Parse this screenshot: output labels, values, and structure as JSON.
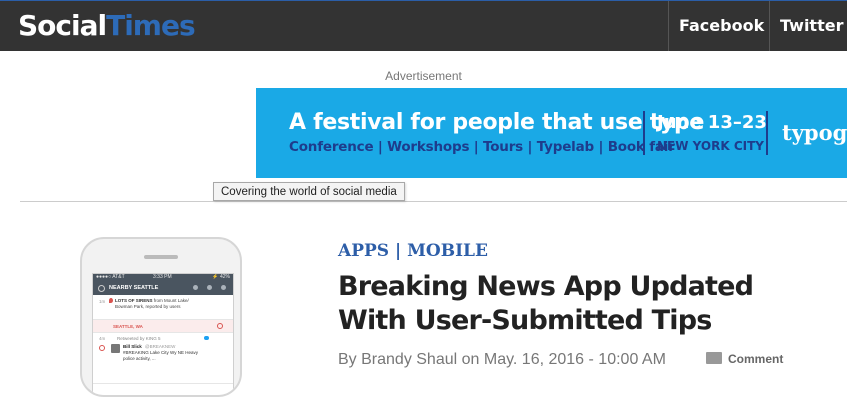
{
  "header": {
    "logo_part1": "Social",
    "logo_part2": "Times",
    "nav": [
      {
        "label": "Facebook"
      },
      {
        "label": "Twitter"
      }
    ],
    "colors": {
      "bar": "#333333",
      "logo_accent": "#2d6bb8"
    }
  },
  "ad": {
    "label": "Advertisement",
    "headline": "A festival for people that use type",
    "subline": "Conference | Workshops | Tours | Typelab | Book fair",
    "dates": "June 13–23",
    "city": "NEW YORK CITY",
    "brand": "typog",
    "colors": {
      "background": "#1aa9e6",
      "accent": "#1e3c8c"
    }
  },
  "tooltip": {
    "text": "Covering the world of social media"
  },
  "article": {
    "categories": [
      "APPS",
      "MOBILE"
    ],
    "category_separator": "|",
    "title": "Breaking News App Updated With User-Submitted Tips",
    "byline": "By Brandy Shaul on May. 16, 2016 - 10:00 AM",
    "comment_label": "Comment",
    "thumbnail": {
      "status_carrier": "●●●●○ AT&T",
      "status_time": "3:33 PM",
      "status_battery": "⚡ 42%",
      "header_title": "NEARBY SEATTLE",
      "item1_time": "1m",
      "item1_text_bold": "LOTS OF SIRENS",
      "item1_text": "from Mount Lake/ Bowman Park, reported by users",
      "item2_label": "SEATTLE, WA",
      "item3_time": "4m",
      "item3_retweet": "Retweeted by KING 5",
      "item3_name": "Bill Slick",
      "item3_handle": "@BREAKNEW",
      "item3_body": "#BREAKING Lake City Wy NE Heavy police activity, ..."
    }
  }
}
